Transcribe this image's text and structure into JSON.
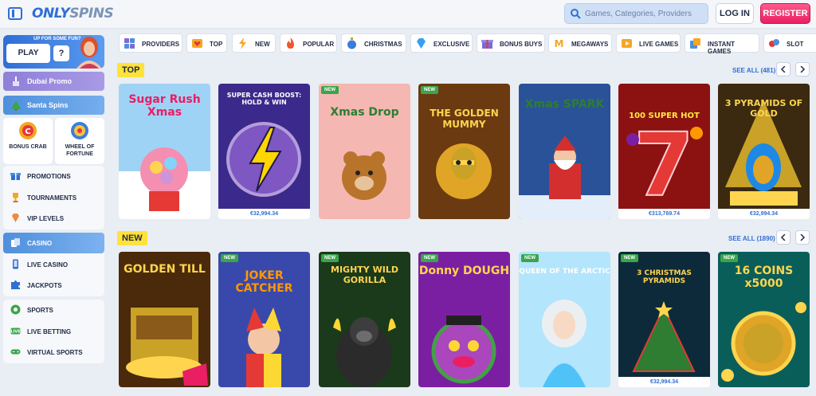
{
  "header": {
    "logo_a": "ONLY",
    "logo_b": "SPINS",
    "search_placeholder": "Games, Categories, Providers",
    "login": "LOG IN",
    "register": "REGISTER"
  },
  "sidebar": {
    "promo": {
      "tag": "UP FOR SOME FUN?",
      "play": "PLAY",
      "help": "?"
    },
    "strips": [
      {
        "label": "Dubai Promo",
        "icon": "dubai-icon"
      },
      {
        "label": "Santa Spins",
        "icon": "tree-icon"
      }
    ],
    "tiles": [
      {
        "label": "BONUS CRAB",
        "icon": "crab-icon"
      },
      {
        "label": "WHEEL OF FORTUNE",
        "icon": "wheel-icon"
      }
    ],
    "group1": [
      {
        "label": "PROMOTIONS",
        "icon": "gift-icon"
      },
      {
        "label": "TOURNAMENTS",
        "icon": "trophy-icon"
      },
      {
        "label": "VIP LEVELS",
        "icon": "diamond-icon"
      }
    ],
    "group2": [
      {
        "label": "CASINO",
        "icon": "casino-icon",
        "active": true
      },
      {
        "label": "LIVE CASINO",
        "icon": "phone-icon"
      },
      {
        "label": "JACKPOTS",
        "icon": "puzzle-icon"
      }
    ],
    "group3": [
      {
        "label": "SPORTS",
        "icon": "ball-icon"
      },
      {
        "label": "LIVE BETTING",
        "icon": "live-icon"
      },
      {
        "label": "VIRTUAL SPORTS",
        "icon": "controller-icon"
      }
    ]
  },
  "categories": [
    {
      "label": "PROVIDERS",
      "icon": "providers-icon"
    },
    {
      "label": "TOP",
      "icon": "heart-icon"
    },
    {
      "label": "NEW",
      "icon": "bolt-icon"
    },
    {
      "label": "POPULAR",
      "icon": "fire-icon"
    },
    {
      "label": "CHRISTMAS",
      "icon": "ornament-icon"
    },
    {
      "label": "EXCLUSIVE",
      "icon": "gem-icon"
    },
    {
      "label": "BONUS BUYS",
      "icon": "giftbox-icon"
    },
    {
      "label": "MEGAWAYS",
      "icon": "megaways-icon"
    },
    {
      "label": "LIVE GAMES",
      "icon": "live-games-icon"
    },
    {
      "label": "INSTANT GAMES",
      "icon": "instant-icon"
    },
    {
      "label": "SLOT",
      "icon": "slot-icon"
    }
  ],
  "top": {
    "title": "TOP",
    "see_all": "SEE ALL (481)",
    "games": [
      {
        "name": "Sugar Rush Xmas",
        "jackpot": "",
        "badge": ""
      },
      {
        "name": "SUPER CASH BOOST: HOLD & WIN",
        "jackpot": "€32,994.34",
        "badge": ""
      },
      {
        "name": "Xmas Drop",
        "jackpot": "",
        "badge": "NEW"
      },
      {
        "name": "THE GOLDEN MUMMY",
        "jackpot": "",
        "badge": "NEW"
      },
      {
        "name": "Xmas SPARK",
        "jackpot": "",
        "badge": ""
      },
      {
        "name": "100 SUPER HOT",
        "jackpot": "€313,769.74",
        "badge": ""
      },
      {
        "name": "3 PYRAMIDS OF GOLD",
        "jackpot": "€32,994.34",
        "badge": ""
      }
    ]
  },
  "new": {
    "title": "NEW",
    "see_all": "SEE ALL (1890)",
    "games": [
      {
        "name": "GOLDEN TILL",
        "jackpot": "",
        "badge": ""
      },
      {
        "name": "JOKER CATCHER",
        "jackpot": "",
        "badge": "NEW"
      },
      {
        "name": "MIGHTY WILD GORILLA",
        "jackpot": "",
        "badge": "NEW"
      },
      {
        "name": "Donny DOUGH",
        "jackpot": "",
        "badge": "NEW"
      },
      {
        "name": "QUEEN OF THE ARCTIC",
        "jackpot": "",
        "badge": "NEW"
      },
      {
        "name": "3 CHRISTMAS PYRAMIDS",
        "jackpot": "€32,994.34",
        "badge": "NEW"
      },
      {
        "name": "16 COINS x5000",
        "jackpot": "",
        "badge": "NEW"
      }
    ]
  },
  "colors": {
    "accent": "#2f6fd6",
    "register": "#e91e63",
    "section_tag": "#ffe23a"
  }
}
